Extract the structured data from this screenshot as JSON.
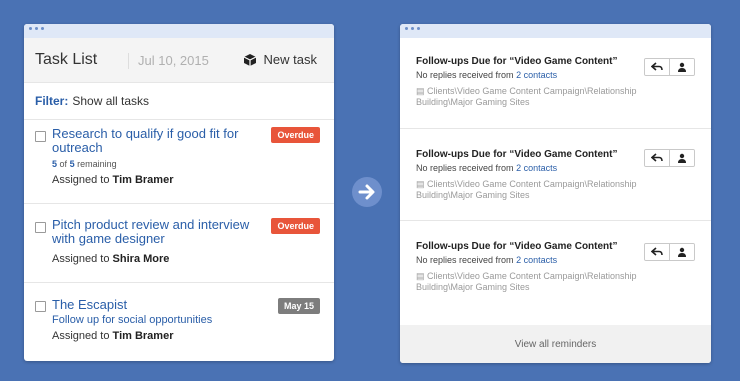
{
  "task_list": {
    "title": "Task List",
    "date": "Jul 10, 2015",
    "new_task_label": "New task",
    "filter_label": "Filter:",
    "filter_value": "Show all tasks",
    "tasks": [
      {
        "title": "Research to qualify if good fit for outreach",
        "badge": "Overdue",
        "remaining_done": "5",
        "remaining_of": "of",
        "remaining_total": "5",
        "remaining_suffix": "remaining",
        "assigned_prefix": "Assigned to",
        "assignee": "Tim Bramer"
      },
      {
        "title": "Pitch product review and interview with game designer",
        "badge": "Overdue",
        "assigned_prefix": "Assigned to",
        "assignee": "Shira More"
      },
      {
        "title": "The Escapist",
        "badge": "May 15",
        "subtitle": "Follow up for social opportunities",
        "assigned_prefix": "Assigned to",
        "assignee": "Tim Bramer"
      }
    ]
  },
  "reminders": {
    "items": [
      {
        "title": "Follow-ups Due for “Video Game Content”",
        "sub_prefix": "No replies received from",
        "sub_link": "2 contacts",
        "path": "Clients\\Video Game Content Campaign\\Relationship Building\\Major Gaming Sites"
      },
      {
        "title": "Follow-ups Due for “Video Game Content”",
        "sub_prefix": "No replies received from",
        "sub_link": "2 contacts",
        "path": "Clients\\Video Game Content Campaign\\Relationship Building\\Major Gaming Sites"
      },
      {
        "title": "Follow-ups Due for “Video Game Content”",
        "sub_prefix": "No replies received from",
        "sub_link": "2 contacts",
        "path": "Clients\\Video Game Content Campaign\\Relationship Building\\Major Gaming Sites"
      }
    ],
    "footer_label": "View all reminders"
  },
  "colors": {
    "background": "#4a72b4",
    "link": "#2a5ea8",
    "overdue": "#e8553a",
    "date_badge": "#7d7d7d"
  },
  "icons": [
    "cube-icon",
    "arrow-right-icon",
    "reply-icon",
    "person-icon",
    "folder-icon"
  ]
}
